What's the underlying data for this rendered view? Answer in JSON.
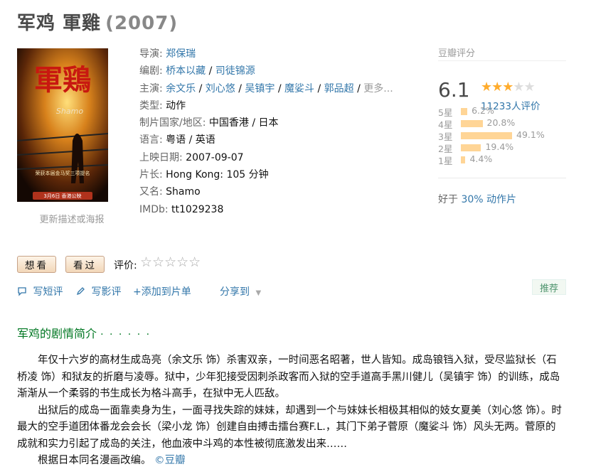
{
  "header": {
    "title": "军鸡 軍雞",
    "year": "(2007)"
  },
  "poster": {
    "big_text": "軍鶏",
    "sub_text": "Shamo",
    "caption_line1": "荣获本届金马奖三项提名",
    "caption_line2": "3月6日 香港公映",
    "update_link": "更新描述或海报"
  },
  "info": {
    "director_label": "导演:",
    "director": "郑保瑞",
    "writer_label": "编剧:",
    "writers": [
      "桥本以藏",
      "司徒锦源"
    ],
    "cast_label": "主演:",
    "cast": [
      "余文乐",
      "刘心悠",
      "吴镇宇",
      "魔娑斗",
      "郭品超"
    ],
    "cast_more": "更多...",
    "genre_label": "类型:",
    "genre": "动作",
    "country_label": "制片国家/地区:",
    "country": "中国香港 / 日本",
    "language_label": "语言:",
    "language": "粤语 / 英语",
    "release_label": "上映日期:",
    "release": "2007-09-07",
    "runtime_label": "片长:",
    "runtime": "Hong Kong: 105 分钟",
    "aka_label": "又名:",
    "aka": "Shamo",
    "imdb_label": "IMDb:",
    "imdb": "tt1029238",
    "separator": "/"
  },
  "rating": {
    "label": "豆瓣评分",
    "score": "6.1",
    "stars_on": "★★★",
    "stars_off": "★★",
    "votes": "11233人评价",
    "distribution": [
      {
        "label": "5星",
        "percent": 6.2,
        "text": "6.2%"
      },
      {
        "label": "4星",
        "percent": 20.8,
        "text": "20.8%"
      },
      {
        "label": "3星",
        "percent": 49.1,
        "text": "49.1%"
      },
      {
        "label": "2星",
        "percent": 19.4,
        "text": "19.4%"
      },
      {
        "label": "1星",
        "percent": 4.4,
        "text": "4.4%"
      }
    ],
    "better_prefix": "好于 ",
    "better_link": "30% 动作片"
  },
  "actions": {
    "want": "想看",
    "seen": "看过",
    "rate_label": "评价:",
    "rate_stars": "☆☆☆☆☆",
    "short_review": "写短评",
    "review": "写影评",
    "add_list": "+添加到片单",
    "share": "分享到",
    "recommend": "推荐"
  },
  "summary": {
    "title": "军鸡的剧情简介",
    "dots": "· · · · · ·",
    "p1": "年仅十六岁的高材生成岛亮（余文乐 饰）杀害双亲，一时间恶名昭著，世人皆知。成岛锒铛入狱，受尽监狱长（石桥凌 饰）和狱友的折磨与凌辱。狱中，少年犯接受因刺杀政客而入狱的空手道高手黑川健儿（吴镇宇 饰）的训练，成岛渐渐从一个柔弱的书生成长为格斗高手，在狱中无人匹敌。",
    "p2": "出狱后的成岛一面靠卖身为生，一面寻找失踪的妹妹，却遇到一个与妹妹长相极其相似的妓女夏美（刘心悠 饰）。时最大的空手道团体番龙会会长（梁小龙 饰）创建自由搏击擂台赛F.L.，其门下弟子菅原（魔娑斗 饰）风头无两。菅原的成就和实力引起了成岛的关注，他血液中斗鸡的本性被彻底激发出来……",
    "p3_text": "根据日本同名漫画改编。",
    "p3_link": "©豆瓣"
  },
  "colors": {
    "link": "#3377aa",
    "star": "#ffac2d",
    "bar": "#ffd596",
    "section": "#007722"
  }
}
